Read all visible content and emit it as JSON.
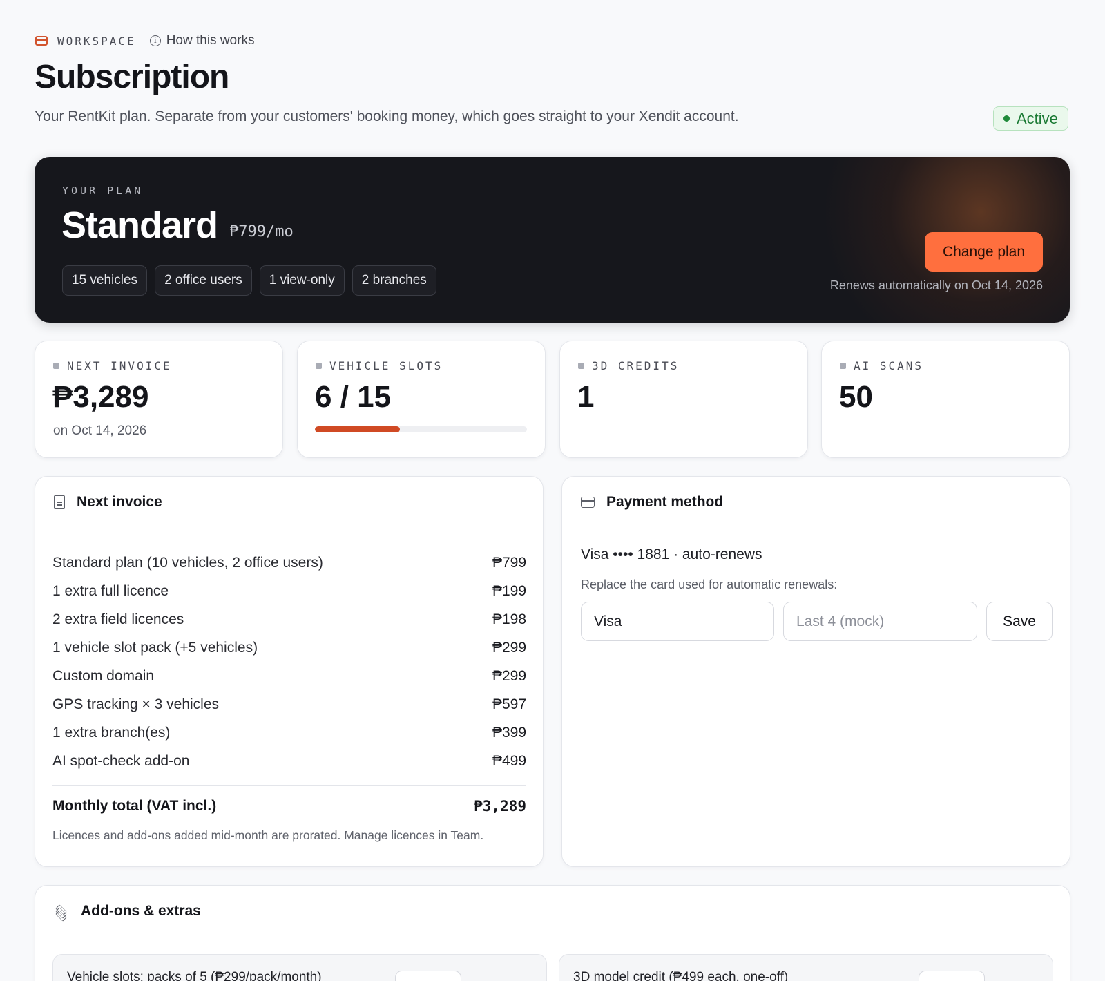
{
  "header": {
    "eyebrow": "WORKSPACE",
    "how_link": "How this works",
    "title": "Subscription",
    "subtitle": "Your RentKit plan. Separate from your customers' booking money, which goes straight to your Xendit account.",
    "status": "Active"
  },
  "plan": {
    "eyebrow": "YOUR PLAN",
    "name": "Standard",
    "price": "₱799/mo",
    "chips": [
      "15 vehicles",
      "2 office users",
      "1 view-only",
      "2 branches"
    ],
    "change_label": "Change plan",
    "renews": "Renews automatically on Oct 14, 2026"
  },
  "stats": [
    {
      "label": "NEXT INVOICE",
      "value": "₱3,289",
      "sub": "on Oct 14, 2026"
    },
    {
      "label": "VEHICLE SLOTS",
      "value": "6 / 15",
      "used": 6,
      "total": 15
    },
    {
      "label": "3D CREDITS",
      "value": "1"
    },
    {
      "label": "AI SCANS",
      "value": "50"
    }
  ],
  "invoice": {
    "title": "Next invoice",
    "lines": [
      {
        "label": "Standard plan (10 vehicles, 2 office users)",
        "amount": "₱799"
      },
      {
        "label": "1 extra full licence",
        "amount": "₱199"
      },
      {
        "label": "2 extra field licences",
        "amount": "₱198"
      },
      {
        "label": "1 vehicle slot pack (+5 vehicles)",
        "amount": "₱299"
      },
      {
        "label": "Custom domain",
        "amount": "₱299"
      },
      {
        "label": "GPS tracking × 3 vehicles",
        "amount": "₱597"
      },
      {
        "label": "1 extra branch(es)",
        "amount": "₱399"
      },
      {
        "label": "AI spot-check add-on",
        "amount": "₱499"
      }
    ],
    "total_label": "Monthly total (VAT incl.)",
    "total_amount": "₱3,289",
    "note": "Licences and add-ons added mid-month are prorated. Manage licences in Team."
  },
  "payment": {
    "title": "Payment method",
    "card": "Visa •••• 1881 · auto-renews",
    "help": "Replace the card used for automatic renewals:",
    "brand_value": "Visa",
    "last4_placeholder": "Last 4 (mock)",
    "save_label": "Save"
  },
  "addons": {
    "title": "Add-ons & extras",
    "items": [
      {
        "label": "Vehicle slots: packs of 5 (₱299/pack/month)"
      },
      {
        "label": "3D model credit (₱499 each, one-off)"
      }
    ]
  },
  "colors": {
    "accent": "#ff6f3e",
    "progress": "#d04a24",
    "active_green": "#1f8a3a",
    "plan_bg": "#16171c"
  }
}
